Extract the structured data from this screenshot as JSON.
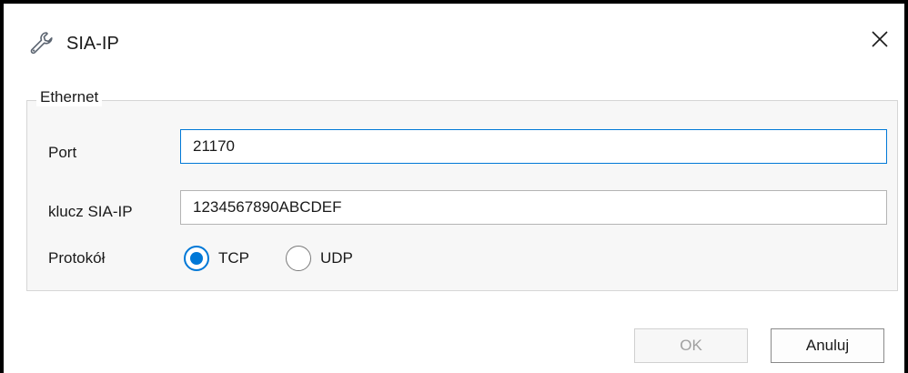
{
  "window": {
    "title": "SIA-IP",
    "icon": "wrench-icon",
    "close_icon": "close-icon"
  },
  "ethernet": {
    "group_title": "Ethernet",
    "port_label": "Port",
    "port_value": "21170",
    "key_label": "klucz SIA-IP",
    "key_value": "1234567890ABCDEF",
    "protocol_label": "Protokół",
    "protocol_options": [
      {
        "label": "TCP",
        "selected": true
      },
      {
        "label": "UDP",
        "selected": false
      }
    ]
  },
  "buttons": {
    "ok_label": "OK",
    "ok_enabled": false,
    "cancel_label": "Anuluj"
  },
  "colors": {
    "accent": "#0078d7",
    "group_background": "#f7f7f7",
    "disabled_text": "#a0a0a0"
  }
}
